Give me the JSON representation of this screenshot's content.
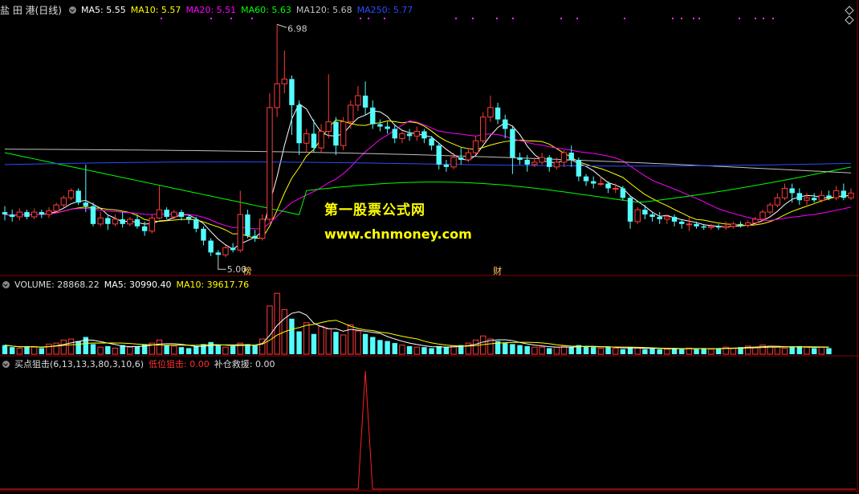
{
  "main_header": {
    "stock_name": "盐 田 港(日线)",
    "ma5": "MA5: 5.55",
    "ma10": "MA10: 5.57",
    "ma20": "MA20: 5.51",
    "ma60": "MA60: 5.63",
    "ma120": "MA120: 5.68",
    "ma250": "MA250: 5.77"
  },
  "vol_header": {
    "volume": "VOLUME: 28868.22",
    "ma5": "MA5: 30990.40",
    "ma10": "MA10: 39617.76"
  },
  "ind_header": {
    "name": "买点狙击(6,13,13,3,80,3,10,6)",
    "low_snipe": "低位狙击: 0.00",
    "rescue": "补仓救援: 0.00"
  },
  "watermark": {
    "line1": "第一股票公式网",
    "line2": "www.chnmoney.com"
  },
  "colors": {
    "up": "#ff3b3b",
    "down": "#54fcfc",
    "ma5": "#ffffff",
    "ma10": "#ffff00",
    "ma20": "#ff00ff",
    "ma60": "#00ff00",
    "ma120": "#c0c0c0",
    "ma250": "#2a4cff",
    "grid": "#8b0000"
  },
  "chart_data": {
    "type": "candlestick",
    "high_label": "6.98",
    "low_label": "5.00",
    "high_price": 6.98,
    "low_price": 5.0,
    "event_labels": [
      "榜",
      "财"
    ],
    "candles": [
      [
        5.4,
        5.38,
        5.45,
        5.33
      ],
      [
        5.38,
        5.36,
        5.42,
        5.32
      ],
      [
        5.36,
        5.4,
        5.43,
        5.33
      ],
      [
        5.4,
        5.36,
        5.42,
        5.34
      ],
      [
        5.36,
        5.4,
        5.43,
        5.34
      ],
      [
        5.4,
        5.38,
        5.42,
        5.35
      ],
      [
        5.38,
        5.41,
        5.44,
        5.35
      ],
      [
        5.41,
        5.46,
        5.48,
        5.39
      ],
      [
        5.46,
        5.52,
        5.54,
        5.44
      ],
      [
        5.52,
        5.58,
        5.6,
        5.5
      ],
      [
        5.58,
        5.48,
        5.6,
        5.46
      ],
      [
        5.48,
        5.45,
        5.8,
        5.4
      ],
      [
        5.45,
        5.3,
        5.48,
        5.28
      ],
      [
        5.3,
        5.35,
        5.4,
        5.28
      ],
      [
        5.35,
        5.3,
        5.37,
        5.25
      ],
      [
        5.3,
        5.34,
        5.38,
        5.28
      ],
      [
        5.34,
        5.3,
        5.4,
        5.27
      ],
      [
        5.3,
        5.34,
        5.36,
        5.28
      ],
      [
        5.34,
        5.28,
        5.38,
        5.26
      ],
      [
        5.28,
        5.24,
        5.32,
        5.2
      ],
      [
        5.24,
        5.35,
        5.38,
        5.22
      ],
      [
        5.35,
        5.42,
        5.62,
        5.34
      ],
      [
        5.42,
        5.36,
        5.44,
        5.34
      ],
      [
        5.36,
        5.4,
        5.42,
        5.34
      ],
      [
        5.4,
        5.36,
        5.42,
        5.33
      ],
      [
        5.36,
        5.34,
        5.38,
        5.3
      ],
      [
        5.34,
        5.26,
        5.36,
        5.23
      ],
      [
        5.26,
        5.16,
        5.28,
        5.12
      ],
      [
        5.16,
        5.06,
        5.18,
        5.03
      ],
      [
        5.06,
        5.04,
        5.08,
        5.0
      ],
      [
        5.04,
        5.1,
        5.12,
        5.02
      ],
      [
        5.1,
        5.08,
        5.14,
        5.06
      ],
      [
        5.08,
        5.38,
        5.58,
        5.06
      ],
      [
        5.38,
        5.2,
        5.42,
        5.18
      ],
      [
        5.2,
        5.18,
        5.25,
        5.15
      ],
      [
        5.18,
        5.34,
        5.38,
        5.16
      ],
      [
        5.34,
        6.28,
        6.4,
        5.32
      ],
      [
        6.28,
        6.48,
        6.98,
        6.2
      ],
      [
        6.48,
        6.52,
        6.76,
        6.4
      ],
      [
        6.52,
        6.3,
        6.55,
        6.05
      ],
      [
        6.3,
        5.98,
        6.34,
        5.88
      ],
      [
        5.98,
        6.06,
        6.1,
        5.9
      ],
      [
        6.06,
        5.94,
        6.18,
        5.9
      ],
      [
        5.94,
        6.08,
        6.14,
        5.9
      ],
      [
        6.08,
        6.16,
        6.56,
        6.02
      ],
      [
        6.16,
        5.96,
        6.2,
        5.88
      ],
      [
        5.96,
        6.16,
        6.2,
        5.92
      ],
      [
        6.16,
        6.3,
        6.34,
        6.1
      ],
      [
        6.3,
        6.38,
        6.46,
        6.25
      ],
      [
        6.38,
        6.28,
        6.5,
        6.22
      ],
      [
        6.28,
        6.14,
        6.34,
        6.1
      ],
      [
        6.14,
        6.12,
        6.18,
        6.08
      ],
      [
        6.12,
        6.1,
        6.16,
        6.06
      ],
      [
        6.1,
        6.02,
        6.14,
        5.98
      ],
      [
        6.02,
        6.06,
        6.08,
        5.98
      ],
      [
        6.06,
        6.04,
        6.1,
        6.0
      ],
      [
        6.04,
        6.08,
        6.12,
        6.0
      ],
      [
        6.08,
        6.02,
        6.1,
        5.98
      ],
      [
        6.02,
        5.96,
        6.04,
        5.92
      ],
      [
        5.96,
        5.8,
        5.98,
        5.76
      ],
      [
        5.8,
        5.78,
        5.84,
        5.74
      ],
      [
        5.78,
        5.86,
        5.9,
        5.76
      ],
      [
        5.86,
        5.84,
        5.94,
        5.8
      ],
      [
        5.84,
        5.9,
        5.94,
        5.82
      ],
      [
        5.9,
        6.0,
        6.04,
        5.88
      ],
      [
        6.0,
        6.2,
        6.24,
        5.98
      ],
      [
        6.2,
        6.28,
        6.38,
        6.16
      ],
      [
        6.28,
        6.18,
        6.32,
        6.14
      ],
      [
        6.18,
        6.1,
        6.22,
        6.02
      ],
      [
        6.1,
        5.86,
        6.12,
        5.72
      ],
      [
        5.86,
        5.84,
        5.9,
        5.8
      ],
      [
        5.84,
        5.8,
        5.88,
        5.74
      ],
      [
        5.8,
        5.82,
        5.86,
        5.78
      ],
      [
        5.82,
        5.86,
        5.9,
        5.8
      ],
      [
        5.86,
        5.78,
        5.88,
        5.74
      ],
      [
        5.78,
        5.82,
        5.86,
        5.76
      ],
      [
        5.82,
        5.9,
        5.92,
        5.78
      ],
      [
        5.9,
        5.84,
        5.96,
        5.78
      ],
      [
        5.84,
        5.7,
        5.86,
        5.66
      ],
      [
        5.7,
        5.66,
        5.72,
        5.62
      ],
      [
        5.66,
        5.64,
        5.7,
        5.6
      ],
      [
        5.64,
        5.64,
        5.7,
        5.62
      ],
      [
        5.64,
        5.6,
        5.66,
        5.56
      ],
      [
        5.6,
        5.6,
        5.64,
        5.56
      ],
      [
        5.6,
        5.52,
        5.62,
        5.5
      ],
      [
        5.52,
        5.32,
        5.54,
        5.26
      ],
      [
        5.32,
        5.42,
        5.44,
        5.3
      ],
      [
        5.42,
        5.38,
        5.46,
        5.34
      ],
      [
        5.38,
        5.36,
        5.4,
        5.32
      ],
      [
        5.36,
        5.34,
        5.4,
        5.3
      ],
      [
        5.34,
        5.36,
        5.38,
        5.3
      ],
      [
        5.36,
        5.32,
        5.38,
        5.28
      ],
      [
        5.32,
        5.3,
        5.34,
        5.26
      ],
      [
        5.3,
        5.3,
        5.36,
        5.24
      ],
      [
        5.3,
        5.28,
        5.32,
        5.26
      ],
      [
        5.28,
        5.27,
        5.3,
        5.25
      ],
      [
        5.27,
        5.28,
        5.3,
        5.25
      ],
      [
        5.28,
        5.27,
        5.3,
        5.25
      ],
      [
        5.27,
        5.28,
        5.32,
        5.25
      ],
      [
        5.28,
        5.3,
        5.32,
        5.26
      ],
      [
        5.3,
        5.29,
        5.32,
        5.27
      ],
      [
        5.29,
        5.31,
        5.33,
        5.27
      ],
      [
        5.31,
        5.34,
        5.36,
        5.29
      ],
      [
        5.34,
        5.4,
        5.42,
        5.32
      ],
      [
        5.4,
        5.46,
        5.48,
        5.38
      ],
      [
        5.46,
        5.52,
        5.56,
        5.44
      ],
      [
        5.52,
        5.6,
        5.64,
        5.5
      ],
      [
        5.6,
        5.56,
        5.64,
        5.48
      ],
      [
        5.56,
        5.5,
        5.6,
        5.46
      ],
      [
        5.5,
        5.52,
        5.56,
        5.46
      ],
      [
        5.52,
        5.5,
        5.56,
        5.48
      ],
      [
        5.5,
        5.54,
        5.58,
        5.48
      ],
      [
        5.54,
        5.52,
        5.58,
        5.5
      ],
      [
        5.52,
        5.58,
        5.62,
        5.5
      ],
      [
        5.58,
        5.52,
        5.64,
        5.5
      ],
      [
        5.52,
        5.56,
        5.6,
        5.5
      ]
    ],
    "volume": [
      18,
      14,
      12,
      16,
      14,
      12,
      20,
      22,
      28,
      30,
      26,
      34,
      20,
      14,
      16,
      12,
      18,
      14,
      16,
      20,
      22,
      28,
      18,
      16,
      14,
      12,
      16,
      20,
      24,
      18,
      14,
      16,
      22,
      20,
      18,
      30,
      95,
      120,
      88,
      70,
      45,
      62,
      40,
      55,
      50,
      44,
      38,
      58,
      46,
      40,
      34,
      28,
      26,
      22,
      18,
      16,
      14,
      14,
      12,
      16,
      14,
      16,
      18,
      22,
      28,
      36,
      30,
      26,
      22,
      20,
      18,
      16,
      14,
      14,
      12,
      14,
      16,
      14,
      18,
      16,
      14,
      12,
      14,
      12,
      10,
      14,
      12,
      10,
      12,
      10,
      10,
      12,
      10,
      12,
      10,
      12,
      10,
      12,
      14,
      12,
      14,
      16,
      14,
      18,
      16,
      14,
      12,
      14,
      16,
      14,
      12,
      14,
      12
    ],
    "indicator_spike_index": 49
  }
}
